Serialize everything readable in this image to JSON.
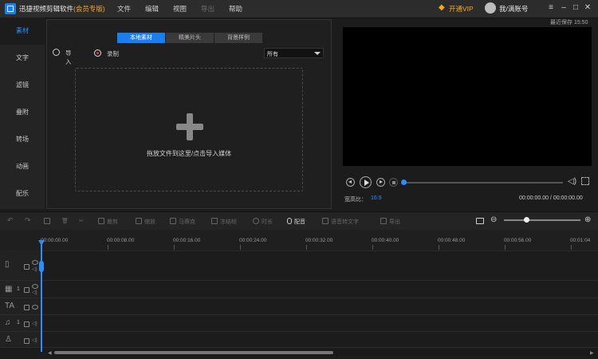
{
  "app": {
    "title": "迅捷视频剪辑软件",
    "badge": "(会员专版)",
    "menu": [
      "文件",
      "编辑",
      "视图",
      "导出",
      "帮助"
    ],
    "vip": "开通VIP",
    "account": "我/满账号",
    "last_saved": "最近保存 15:50",
    "accent_color": "#2e8cff",
    "vip_color": "#f5a623"
  },
  "sidebar": {
    "items": [
      {
        "label": "素材",
        "active": true
      },
      {
        "label": "文字"
      },
      {
        "label": "滤镜"
      },
      {
        "label": "叠附"
      },
      {
        "label": "转场"
      },
      {
        "label": "动画"
      },
      {
        "label": "配乐"
      }
    ]
  },
  "media_panel": {
    "tabs": [
      "本地素材",
      "精美片头",
      "背景样例"
    ],
    "active_tab": "本地素材",
    "import_label": "导入",
    "record_label": "录制",
    "filter_value": "所有",
    "drop_text": "拖放文件到这里/点击导入媒体"
  },
  "player": {
    "ratio_label": "宽高比：",
    "ratio_value": "16:9",
    "time": "00:00:00.00 / 00:00:00.00",
    "progress": 0
  },
  "toolbar": {
    "items": [
      "裁剪",
      "缩放",
      "马赛克",
      "冻结帧",
      "时长",
      "配音",
      "语音转文字",
      "导出"
    ],
    "enabled_item": "配音"
  },
  "timeline": {
    "ticks": [
      "00:00:00.00",
      "00:00:08.00",
      "00:00:16.00",
      "00:00:24.00",
      "00:00:32.00",
      "00:00:40.00",
      "00:00:48.00",
      "00:00:56.00",
      "00:01:04"
    ],
    "tracks": [
      {
        "icon": "video-track-icon",
        "num": ""
      },
      {
        "icon": "film-icon",
        "num": "1"
      },
      {
        "icon": "text-track-icon",
        "num": ""
      },
      {
        "icon": "music-icon",
        "num": "1"
      },
      {
        "icon": "mic-icon",
        "num": ""
      }
    ]
  }
}
